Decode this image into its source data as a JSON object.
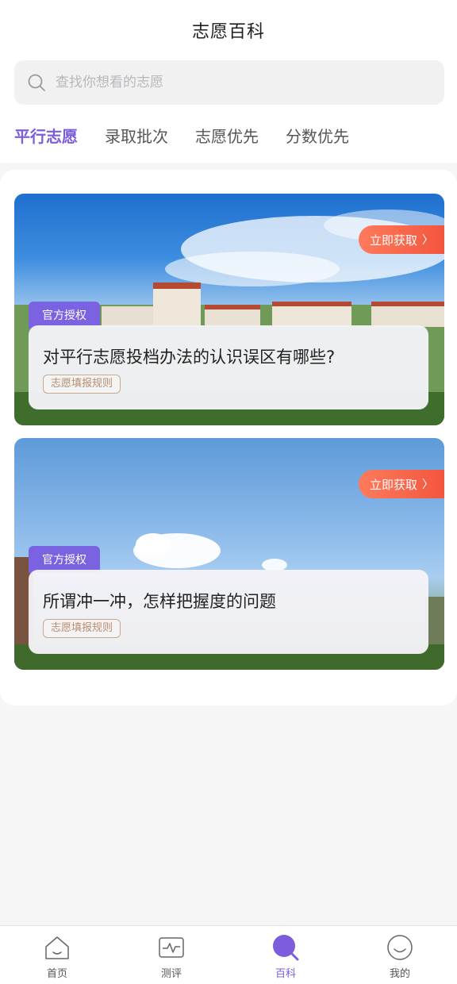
{
  "header": {
    "title": "志愿百科"
  },
  "search": {
    "placeholder": "查找你想看的志愿"
  },
  "tabs": [
    {
      "label": "平行志愿",
      "active": true
    },
    {
      "label": "录取批次",
      "active": false
    },
    {
      "label": "志愿优先",
      "active": false
    },
    {
      "label": "分数优先",
      "active": false
    }
  ],
  "cards": [
    {
      "cta": "立即获取",
      "badge": "官方授权",
      "headline": "对平行志愿投档办法的认识误区有哪些?",
      "tag": "志愿填报规则"
    },
    {
      "cta": "立即获取",
      "badge": "官方授权",
      "headline": "所谓冲一冲，怎样把握度的问题",
      "tag": "志愿填报规则"
    }
  ],
  "bottom_nav": [
    {
      "label": "首页",
      "icon": "home-icon",
      "active": false
    },
    {
      "label": "测评",
      "icon": "pulse-icon",
      "active": false
    },
    {
      "label": "百科",
      "icon": "search-icon",
      "active": true
    },
    {
      "label": "我的",
      "icon": "smile-icon",
      "active": false
    }
  ],
  "colors": {
    "accent": "#7b5ddd",
    "cta": "#f2563e",
    "badge": "#7b62e0",
    "tag_border": "#c9a88c"
  }
}
